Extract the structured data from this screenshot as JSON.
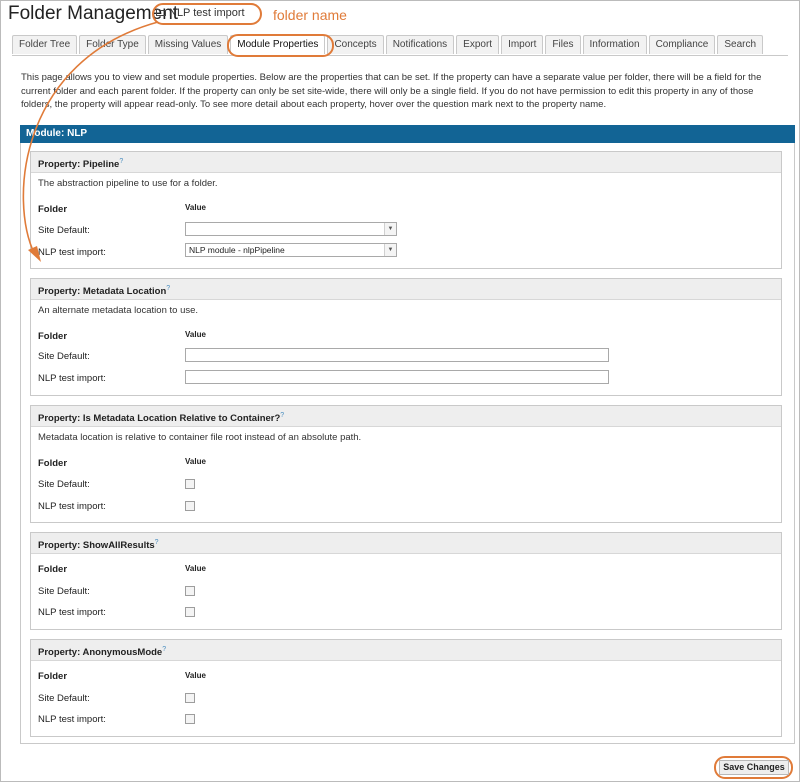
{
  "page": {
    "title": "Folder Management",
    "breadcrumb_folder": "NLP test import",
    "annotation_folder_name": "folder name",
    "accent_color": "#e07b39",
    "module_header_color": "#126495"
  },
  "tabs": [
    {
      "label": "Folder Tree"
    },
    {
      "label": "Folder Type"
    },
    {
      "label": "Missing Values"
    },
    {
      "label": "Module Properties",
      "active": true
    },
    {
      "label": "Concepts"
    },
    {
      "label": "Notifications"
    },
    {
      "label": "Export"
    },
    {
      "label": "Import"
    },
    {
      "label": "Files"
    },
    {
      "label": "Information"
    },
    {
      "label": "Compliance"
    },
    {
      "label": "Search"
    }
  ],
  "intro": "This page allows you to view and set module properties. Below are the properties that can be set. If the property can have a separate value per folder, there will be a field for the current folder and each parent folder. If the property can only be set site-wide, there will only be a single field. If you do not have permission to edit this property in any of those folders, the property will appear read-only. To see more detail about each property, hover over the question mark next to the property name.",
  "module": {
    "header": "Module: NLP"
  },
  "columns": {
    "folder": "Folder",
    "value": "Value"
  },
  "rows": {
    "site_default": "Site Default:",
    "folder": "NLP test import:"
  },
  "properties": [
    {
      "title": "Property: Pipeline",
      "help": "?",
      "description": "The abstraction pipeline to use for a folder.",
      "type": "select",
      "site_value": "",
      "folder_value": "NLP module - nlpPipeline"
    },
    {
      "title": "Property: Metadata Location",
      "help": "?",
      "description": "An alternate metadata location to use.",
      "type": "text",
      "site_value": "",
      "folder_value": ""
    },
    {
      "title": "Property: Is Metadata Location Relative to Container?",
      "help": "?",
      "description": "Metadata location is relative to container file root instead of an absolute path.",
      "type": "checkbox",
      "site_value": false,
      "folder_value": false
    },
    {
      "title": "Property: ShowAllResults",
      "help": "?",
      "description": "",
      "type": "checkbox",
      "site_value": false,
      "folder_value": false
    },
    {
      "title": "Property: AnonymousMode",
      "help": "?",
      "description": "",
      "type": "checkbox",
      "site_value": false,
      "folder_value": false
    }
  ],
  "save_button": "Save Changes"
}
